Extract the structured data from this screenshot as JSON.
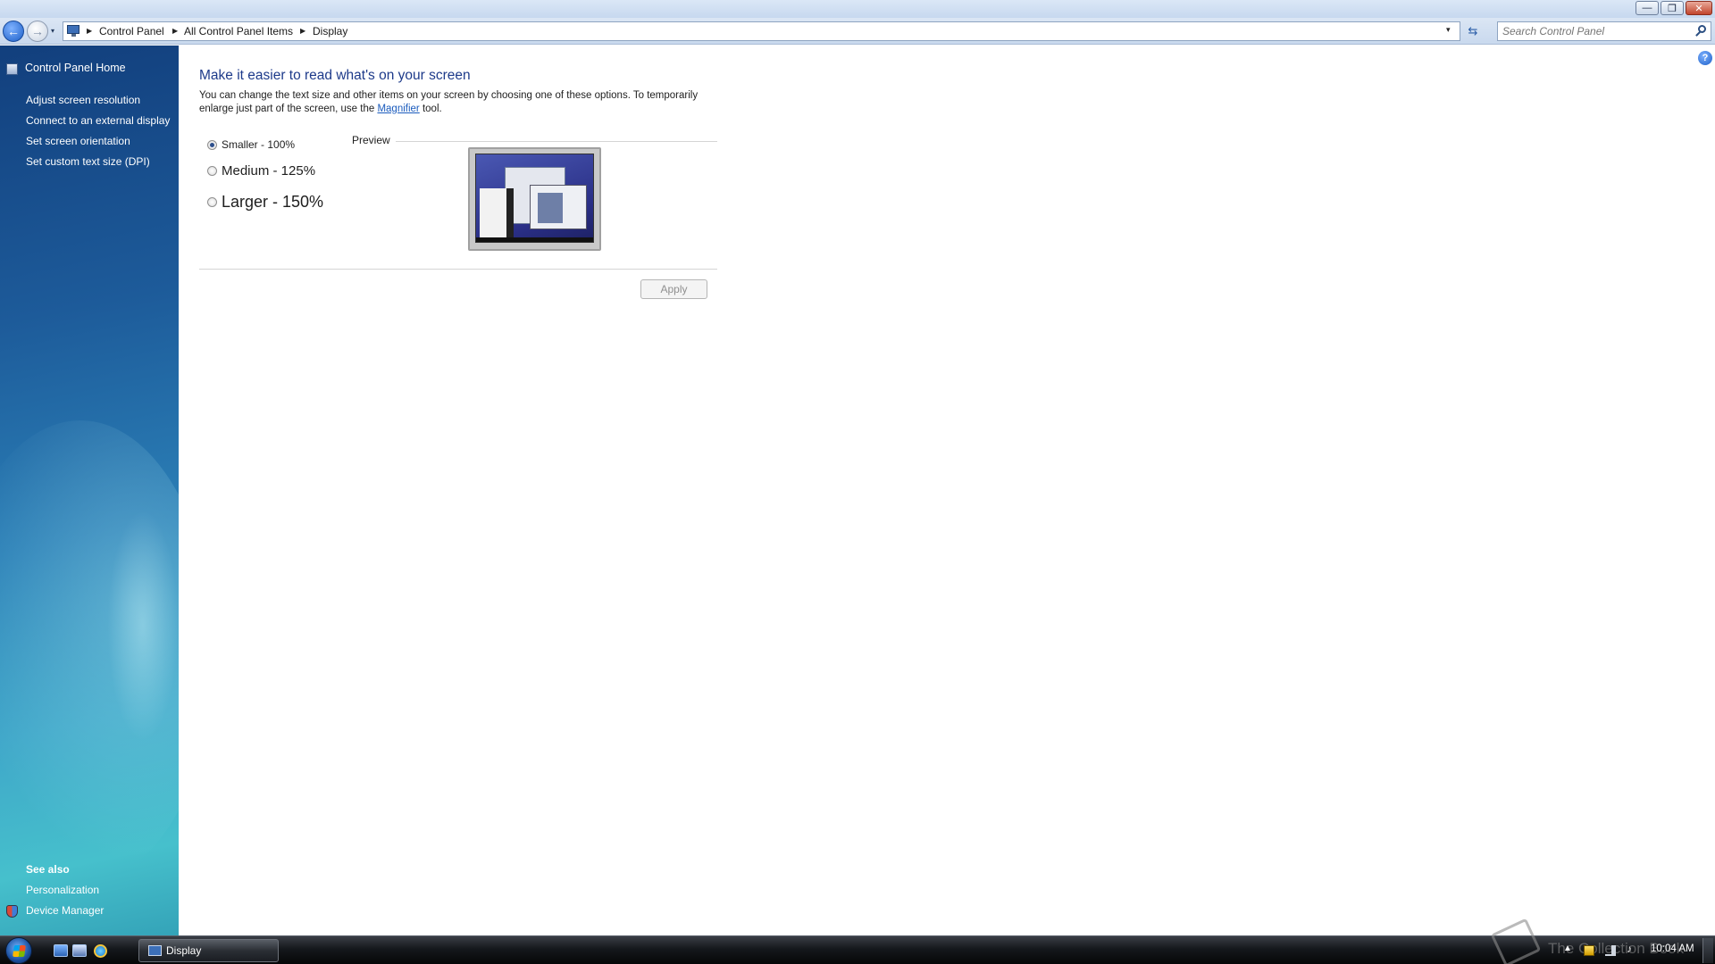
{
  "window": {
    "minimize_glyph": "—",
    "maximize_glyph": "❐",
    "close_glyph": "✕"
  },
  "nav": {
    "back_glyph": "←",
    "forward_glyph": "→",
    "recent_glyph": "▾",
    "breadcrumb": [
      "Control Panel",
      "All Control Panel Items",
      "Display"
    ],
    "separator_glyph": "▶",
    "dropdown_glyph": "▾",
    "refresh_glyph": "⇆",
    "search_placeholder": "Search Control Panel"
  },
  "sidebar": {
    "home": "Control Panel Home",
    "tasks": [
      "Adjust screen resolution",
      "Connect to an external display",
      "Set screen orientation",
      "Set custom text size (DPI)"
    ],
    "see_also_title": "See also",
    "see_also": [
      "Personalization",
      "Device Manager"
    ]
  },
  "main": {
    "title": "Make it easier to read what's on your screen",
    "description_before": "You can change the text size and other items on your screen by choosing one of these options. To temporarily enlarge just part of the screen, use the ",
    "magnifier_link": "Magnifier",
    "description_after": " tool.",
    "options": [
      {
        "label": "Smaller - 100%",
        "selected": true
      },
      {
        "label": "Medium - 125%",
        "selected": false
      },
      {
        "label": "Larger - 150%",
        "selected": false
      }
    ],
    "preview_label": "Preview",
    "apply_label": "Apply",
    "help_glyph": "?"
  },
  "taskbar": {
    "open_window": "Display",
    "watermark": "The Collection Book",
    "tray_up_glyph": "▲",
    "volume_glyph": "♪",
    "clock": "10:04 AM"
  },
  "colors": {
    "sidebar_top": "#123f7d",
    "sidebar_bottom": "#46c0cc",
    "title_blue": "#1d3a8a",
    "link_blue": "#1a5bbd"
  }
}
